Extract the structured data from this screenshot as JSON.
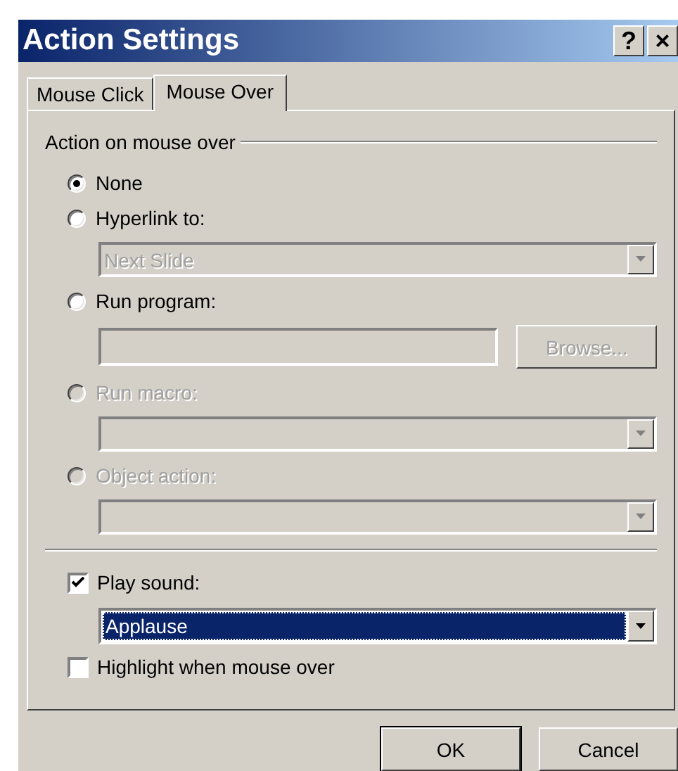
{
  "window": {
    "title": "Action Settings",
    "help_button": "?",
    "close_button": "×"
  },
  "tabs": [
    {
      "label": "Mouse Click",
      "selected": false
    },
    {
      "label": "Mouse Over",
      "selected": true
    }
  ],
  "group": {
    "title": "Action on mouse over"
  },
  "actions": [
    {
      "label": "None",
      "selected": true,
      "disabled": false
    },
    {
      "label": "Hyperlink to:",
      "selected": false,
      "disabled": false,
      "input": {
        "kind": "combo",
        "value": "Next Slide",
        "disabled": true
      }
    },
    {
      "label": "Run program:",
      "selected": false,
      "disabled": false,
      "input": {
        "kind": "field",
        "disabled": true,
        "button": {
          "label": "Browse...",
          "disabled": true
        }
      }
    },
    {
      "label": "Run macro:",
      "selected": false,
      "disabled": true,
      "input": {
        "kind": "combo",
        "disabled": true
      }
    },
    {
      "label": "Object action:",
      "selected": false,
      "disabled": true,
      "input": {
        "kind": "combo",
        "disabled": true
      }
    }
  ],
  "sound": {
    "label": "Play sound:",
    "checked": true,
    "combo": {
      "value": "Applause",
      "disabled": false,
      "focused": true
    }
  },
  "highlight": {
    "label": "Highlight when mouse over",
    "checked": false
  },
  "buttons": [
    {
      "label": "OK",
      "default": true
    },
    {
      "label": "Cancel",
      "default": false
    }
  ]
}
